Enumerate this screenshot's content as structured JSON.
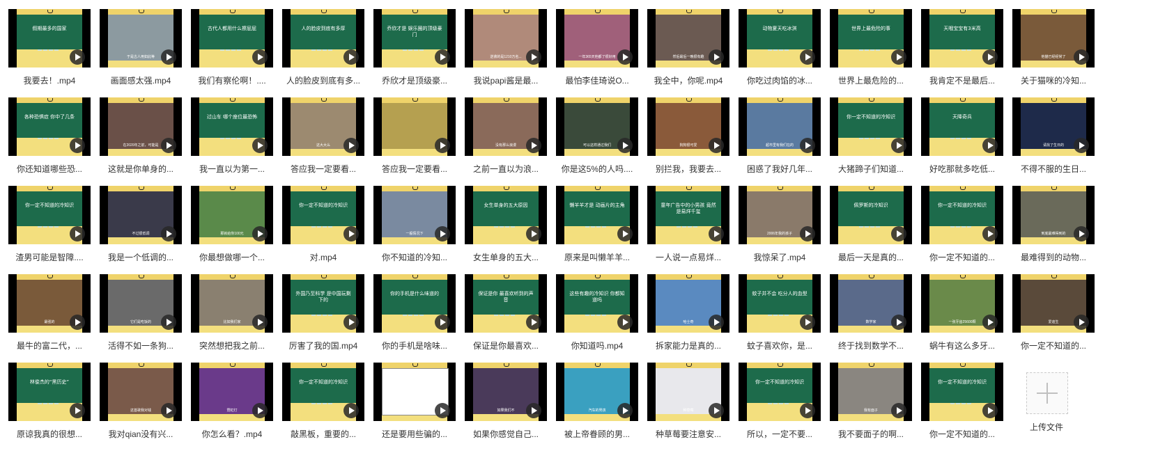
{
  "videos": [
    {
      "caption": "我要去！.mp4",
      "thumb": "board",
      "board_text": "假期最多的国家",
      "sub": ""
    },
    {
      "caption": "画面感太强.mp4",
      "thumb": "photo",
      "color": "#8c9aa0",
      "board_text": "",
      "sub": "于是古人用如此等"
    },
    {
      "caption": "我们有察伦啊！....",
      "thumb": "board",
      "board_text": "古代人都用什么擦屁屁",
      "sub": ""
    },
    {
      "caption": "人的脸皮到底有多...",
      "thumb": "board",
      "board_text": "人的脸皮到底有多厚",
      "sub": ""
    },
    {
      "caption": "乔欣才是顶级豪...",
      "thumb": "board",
      "board_text": "乔欣才是 娱乐圈的顶级豪门",
      "sub": ""
    },
    {
      "caption": "我说papi酱是最...",
      "thumb": "photo",
      "color": "#b08a7a",
      "board_text": "",
      "sub": "逆袭的是1210万名..."
    },
    {
      "caption": "最怕李佳琦说O...",
      "thumb": "photo",
      "color": "#a0607a",
      "board_text": "",
      "sub": "一年365天他都了很好用"
    },
    {
      "caption": "我全中，你呢.mp4",
      "thumb": "photo",
      "color": "#6b5a52",
      "board_text": "",
      "sub": "然后最后一晚很有趣"
    },
    {
      "caption": "你吃过肉馅的冰...",
      "thumb": "board",
      "board_text": "动物夏天吃冰淇",
      "sub": ""
    },
    {
      "caption": "世界上最危险的...",
      "thumb": "board",
      "board_text": "世界上最危险的事",
      "sub": ""
    },
    {
      "caption": "我肯定不是最后...",
      "thumb": "board",
      "board_text": "天哦宝宝有3米高",
      "sub": ""
    },
    {
      "caption": "关于猫咪的冷知...",
      "thumb": "photo",
      "color": "#7a5a3a",
      "board_text": "",
      "sub": "他猫已经经常了"
    },
    {
      "caption": "你还知道哪些恐...",
      "thumb": "board",
      "board_text": "各种恐惧症 你中了几条",
      "sub": ""
    },
    {
      "caption": "这就是你单身的...",
      "thumb": "photo",
      "color": "#6a5048",
      "board_text": "",
      "sub": "在2020年之前，可能是"
    },
    {
      "caption": "我一直以为第一...",
      "thumb": "board",
      "board_text": "过山车 哪个座位最恐怖",
      "sub": ""
    },
    {
      "caption": "答应我一定要看...",
      "thumb": "photo",
      "color": "#9c8a70",
      "board_text": "",
      "sub": "这大大么"
    },
    {
      "caption": "答应我一定要看...",
      "thumb": "photo",
      "color": "#b5a050",
      "board_text": "",
      "sub": ""
    },
    {
      "caption": "之前一直以为浪...",
      "thumb": "photo",
      "color": "#8a6a5a",
      "board_text": "",
      "sub": "没有那么浪漫"
    },
    {
      "caption": "你是这5%的人吗....",
      "thumb": "photo",
      "color": "#3a4a3a",
      "board_text": "",
      "sub": "可以这样通过我们"
    },
    {
      "caption": "别拦我，我要去...",
      "thumb": "photo",
      "color": "#8a5a3a",
      "board_text": "",
      "sub": "狗狗很可爱"
    },
    {
      "caption": "困惑了我好几年...",
      "thumb": "photo",
      "color": "#5a7aa0",
      "board_text": "",
      "sub": "超市里有我们在的"
    },
    {
      "caption": "大猪蹄子们知道...",
      "thumb": "board",
      "board_text": "你一定不知道的冷知识",
      "sub": ""
    },
    {
      "caption": "好吃那就多吃低...",
      "thumb": "board",
      "board_text": "天降奇兵",
      "sub": ""
    },
    {
      "caption": "不得不服的生日...",
      "thumb": "photo",
      "color": "#1e2a4a",
      "board_text": "",
      "sub": "请找了生日的"
    },
    {
      "caption": "渣男可能是智障....",
      "thumb": "board",
      "board_text": "你一定不知道的冷知识",
      "sub": ""
    },
    {
      "caption": "我是一个低调的...",
      "thumb": "photo",
      "color": "#3a3a4a",
      "board_text": "",
      "sub": "不过很低调"
    },
    {
      "caption": "你最想做哪一个...",
      "thumb": "photo",
      "color": "#5a8a4a",
      "board_text": "",
      "sub": "那就给你100元"
    },
    {
      "caption": "对.mp4",
      "thumb": "board",
      "board_text": "你一定不知道的冷知识",
      "sub": ""
    },
    {
      "caption": "你不知道的冷知...",
      "thumb": "photo",
      "color": "#7a8aa0",
      "board_text": "",
      "sub": "一般情况下"
    },
    {
      "caption": "女生单身的五大...",
      "thumb": "board",
      "board_text": "女生单身的五大原因",
      "sub": ""
    },
    {
      "caption": "原来是叫懒羊羊...",
      "thumb": "board",
      "board_text": "懒羊羊才是 动画片的主角",
      "sub": ""
    },
    {
      "caption": "一人说一点易烊...",
      "thumb": "board",
      "board_text": "童年广告中的小男孩 竟然是易烊千玺",
      "sub": ""
    },
    {
      "caption": "我惊呆了.mp4",
      "thumb": "photo",
      "color": "#8a7a6a",
      "board_text": "",
      "sub": "2006年我的孩子"
    },
    {
      "caption": "最后一天是真的...",
      "thumb": "board",
      "board_text": "佩罗斯的冷知识",
      "sub": ""
    },
    {
      "caption": "你一定不知道的...",
      "thumb": "board",
      "board_text": "你一定不知道的冷知识",
      "sub": ""
    },
    {
      "caption": "最难得到的动物...",
      "thumb": "photo",
      "color": "#6a6a5a",
      "board_text": "",
      "sub": "到底最难得到的"
    },
    {
      "caption": "最牛的富二代，...",
      "thumb": "photo",
      "color": "#7a5a3a",
      "board_text": "",
      "sub": "最强的"
    },
    {
      "caption": "活得不如一条狗...",
      "thumb": "photo",
      "color": "#6a6a6a",
      "board_text": "",
      "sub": "它们是吃饭的"
    },
    {
      "caption": "突然想把我之前...",
      "thumb": "photo",
      "color": "#8a8070",
      "board_text": "",
      "sub": "比如我们家"
    },
    {
      "caption": "厉害了我的国.mp4",
      "thumb": "board",
      "board_text": "外国乃至科学 是中国玩剩下的",
      "sub": ""
    },
    {
      "caption": "你的手机是啥味...",
      "thumb": "board",
      "board_text": "你的手机是什么味道的",
      "sub": ""
    },
    {
      "caption": "保证是你最喜欢...",
      "thumb": "board",
      "board_text": "保证是你 最喜欢听到的声音",
      "sub": ""
    },
    {
      "caption": "你知道吗.mp4",
      "thumb": "board",
      "board_text": "这些有趣的冷知识 你都知道吗",
      "sub": ""
    },
    {
      "caption": "拆家能力是真的...",
      "thumb": "photo",
      "color": "#5a8ac0",
      "board_text": "",
      "sub": "哈士奇"
    },
    {
      "caption": "蚊子喜欢你，是...",
      "thumb": "board",
      "board_text": "蚊子并不会 吃分人的血型",
      "sub": ""
    },
    {
      "caption": "终于找到数学不...",
      "thumb": "photo",
      "color": "#5a6a8a",
      "board_text": "",
      "sub": "数学家"
    },
    {
      "caption": "蜗牛有这么多牙...",
      "thumb": "photo",
      "color": "#6a8a4a",
      "board_text": "",
      "sub": "一张牙齿25600颗"
    },
    {
      "caption": "你一定不知道的...",
      "thumb": "photo",
      "color": "#5a4a3a",
      "board_text": "",
      "sub": "爱迪生"
    },
    {
      "caption": "原谅我真的很想...",
      "thumb": "board",
      "board_text": "林俊杰的“黑历史”",
      "sub": ""
    },
    {
      "caption": "我对qian没有兴...",
      "thumb": "photo",
      "color": "#7a5a4a",
      "board_text": "",
      "sub": "这首歌我对钱"
    },
    {
      "caption": "你怎么看？.mp4",
      "thumb": "photo",
      "color": "#6a3a8a",
      "board_text": "",
      "sub": "霓虹灯"
    },
    {
      "caption": "敲黑板，重要的...",
      "thumb": "board",
      "board_text": "你一定不知道的冷知识",
      "sub": ""
    },
    {
      "caption": "还是要用些骗的...",
      "thumb": "meme",
      "color": "#ffffff",
      "board_text": "",
      "sub": ""
    },
    {
      "caption": "如果你感觉自己...",
      "thumb": "photo",
      "color": "#4a3a5a",
      "board_text": "",
      "sub": "如果我们不"
    },
    {
      "caption": "被上帝眷顾的男...",
      "thumb": "photo",
      "color": "#3aa0c0",
      "board_text": "",
      "sub": "汽车的男孩"
    },
    {
      "caption": "种草莓要注意安...",
      "thumb": "photo",
      "color": "#e8e8ec",
      "board_text": "",
      "sub": "种草莓"
    },
    {
      "caption": "所以，一定不要...",
      "thumb": "board",
      "board_text": "你一定不知道的冷知识",
      "sub": ""
    },
    {
      "caption": "我不要面子的啊...",
      "thumb": "photo",
      "color": "#8a8680",
      "board_text": "",
      "sub": "我有面子"
    },
    {
      "caption": "你一定不知道的...",
      "thumb": "board",
      "board_text": "你一定不知道的冷知识",
      "sub": ""
    }
  ],
  "upload": {
    "label": "上传文件"
  }
}
